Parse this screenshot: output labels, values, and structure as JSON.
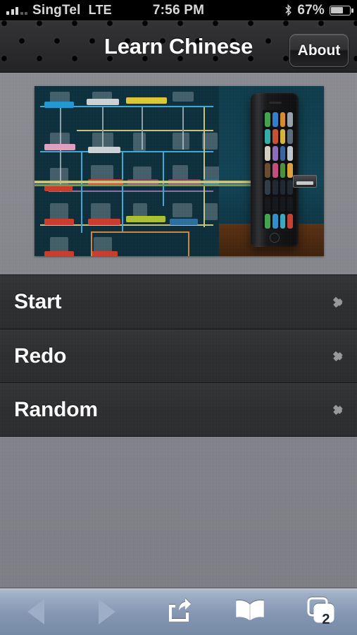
{
  "status_bar": {
    "carrier": "SingTel",
    "network_type": "LTE",
    "time": "7:56 PM",
    "battery_percent": "67%",
    "signal_bars_filled": 3,
    "signal_bars_total": 5,
    "bluetooth_icon": "bluetooth-icon",
    "battery_icon": "battery-icon"
  },
  "nav_bar": {
    "title": "Learn Chinese",
    "about_label": "About"
  },
  "hero": {
    "alt": "network diagram with iphone product photo"
  },
  "menu": {
    "rows": [
      {
        "label": "Start",
        "accessory": "chevron-right-icon"
      },
      {
        "label": "Redo",
        "accessory": "chevron-right-icon"
      },
      {
        "label": "Random",
        "accessory": "chevron-right-icon"
      }
    ]
  },
  "toolbar": {
    "back_label": "Back",
    "forward_label": "Forward",
    "share_label": "Share",
    "bookmarks_label": "Bookmarks",
    "tabs_label": "Tabs",
    "tab_count": "2"
  },
  "colors": {
    "status_bar_bg": "#000000",
    "nav_bar_bg": "#2a2a2c",
    "content_bg": "#86878d",
    "row_bg": "#2b2c2e",
    "row_text": "#ffffff",
    "chevron": "#9a9a9c",
    "toolbar_bg": "#8496b2",
    "toolbar_icon": "#ffffff",
    "toolbar_disabled_icon": "#9daec6"
  }
}
